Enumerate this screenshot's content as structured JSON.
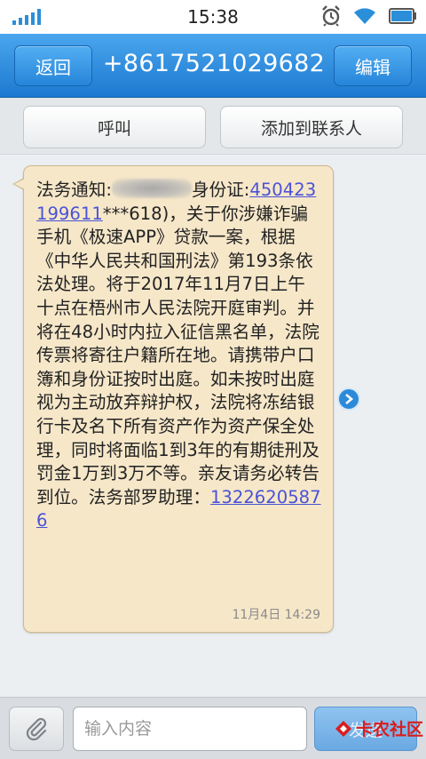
{
  "status_bar": {
    "time": "15:38"
  },
  "header": {
    "back_label": "返回",
    "title": "+8617521029682",
    "edit_label": "编辑"
  },
  "actions": {
    "call_label": "呼叫",
    "add_contact_label": "添加到联系人"
  },
  "message": {
    "part1": "法务通知:",
    "part2": "身份证:",
    "id_link": "450423199611",
    "part3": "***618)，关于你涉嫌诈骗手机《极速APP》贷款一案，根据《中华人民共和国刑法》第193条依法处理。将于2017年11月7日上午十点在梧州市人民法院开庭审判。并将在48小时内拉入征信黑名单，法院传票将寄往户籍所在地。请携带户口簿和身份证按时出庭。如未按时出庭视为主动放弃辩护权，法院将冻结银行卡及名下所有资产作为资产保全处理，同时将面临1到3年的有期徒刑及罚金1万到3万不等。亲友请务必转告到位。法务部罗助理：",
    "phone_link": "13226205876",
    "timestamp": "11月4日 14:29"
  },
  "composer": {
    "placeholder": "输入内容",
    "send_label": "发送"
  },
  "watermark": {
    "text": "卡农社区"
  },
  "icons": {
    "signal": "signal-icon",
    "alarm": "alarm-icon",
    "wifi": "wifi-icon",
    "battery": "battery-icon",
    "detail": "chevron-right-icon",
    "attach": "paperclip-icon"
  },
  "colors": {
    "header_blue": "#1c79cf",
    "bubble": "#f6e7c9",
    "link": "#4a53d6",
    "watermark_red": "#d91d1d"
  }
}
